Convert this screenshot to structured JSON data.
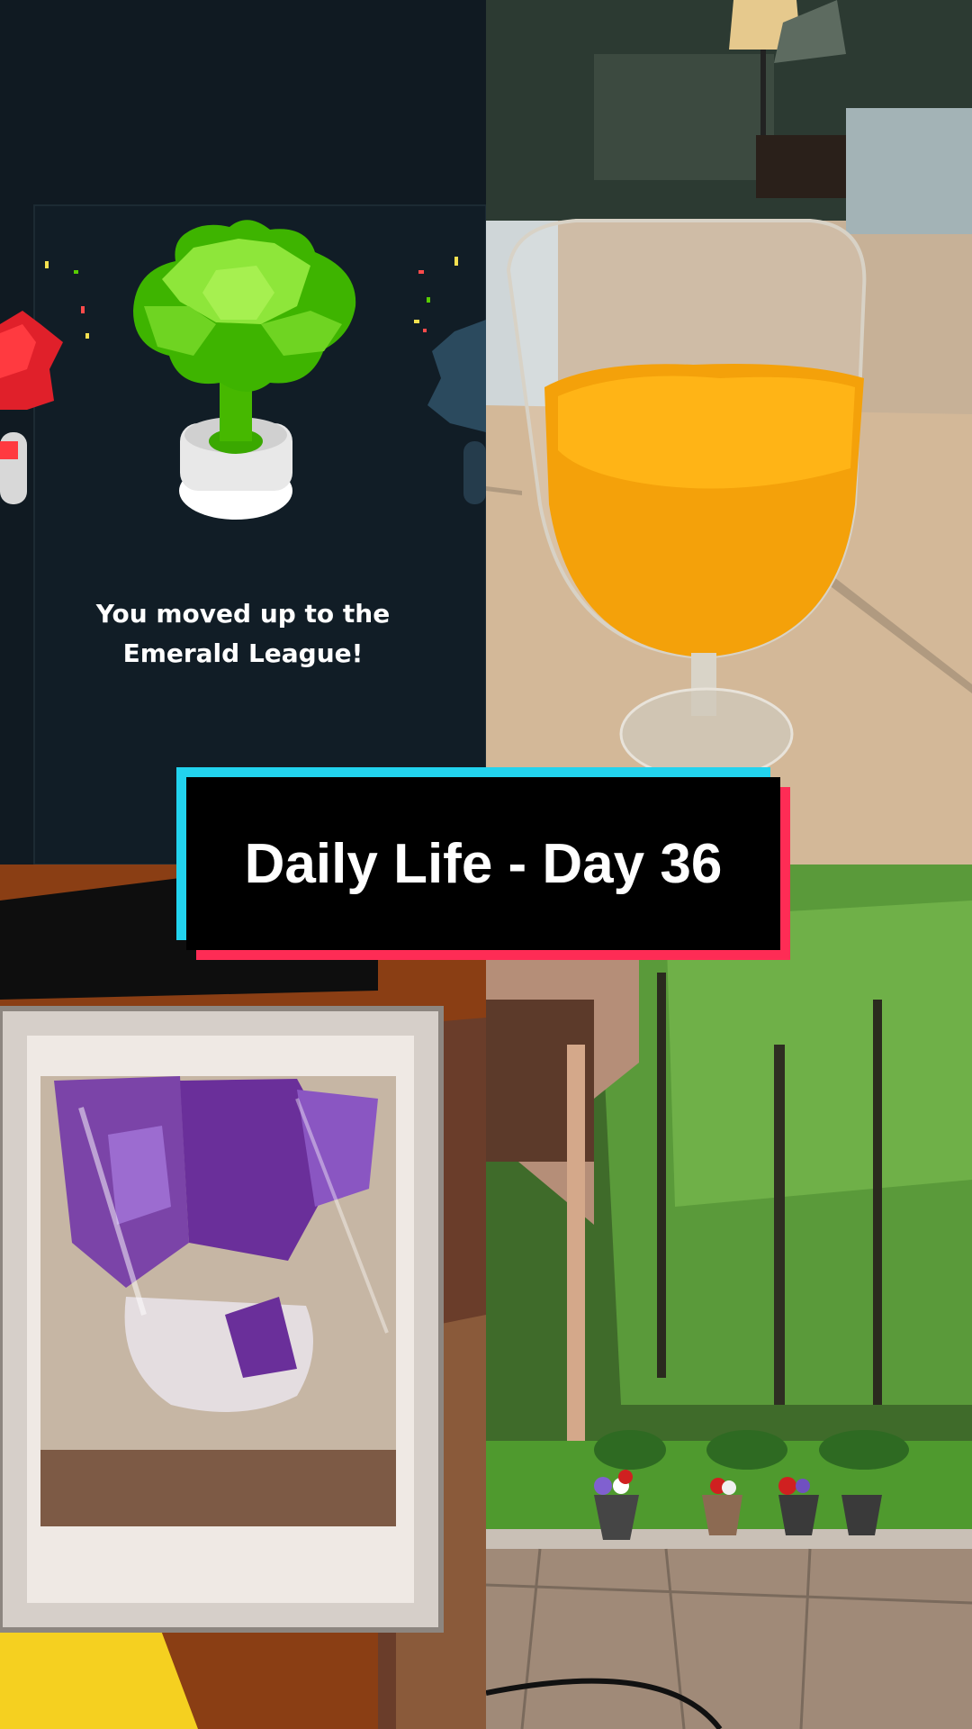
{
  "panels": {
    "top_left": {
      "message_line1": "You moved up to the",
      "message_line2": "Emerald League!",
      "background": "#101a22",
      "accent": "#58cc02"
    },
    "top_right": {
      "subject": "orange-juice-glass"
    },
    "bottom_left": {
      "subject": "lavender-diamond-painting"
    },
    "bottom_right": {
      "subject": "backyard-garden"
    }
  },
  "title": {
    "text": "Daily Life - Day 36",
    "cyan": "#22d3ee",
    "red": "#fe2c55"
  }
}
